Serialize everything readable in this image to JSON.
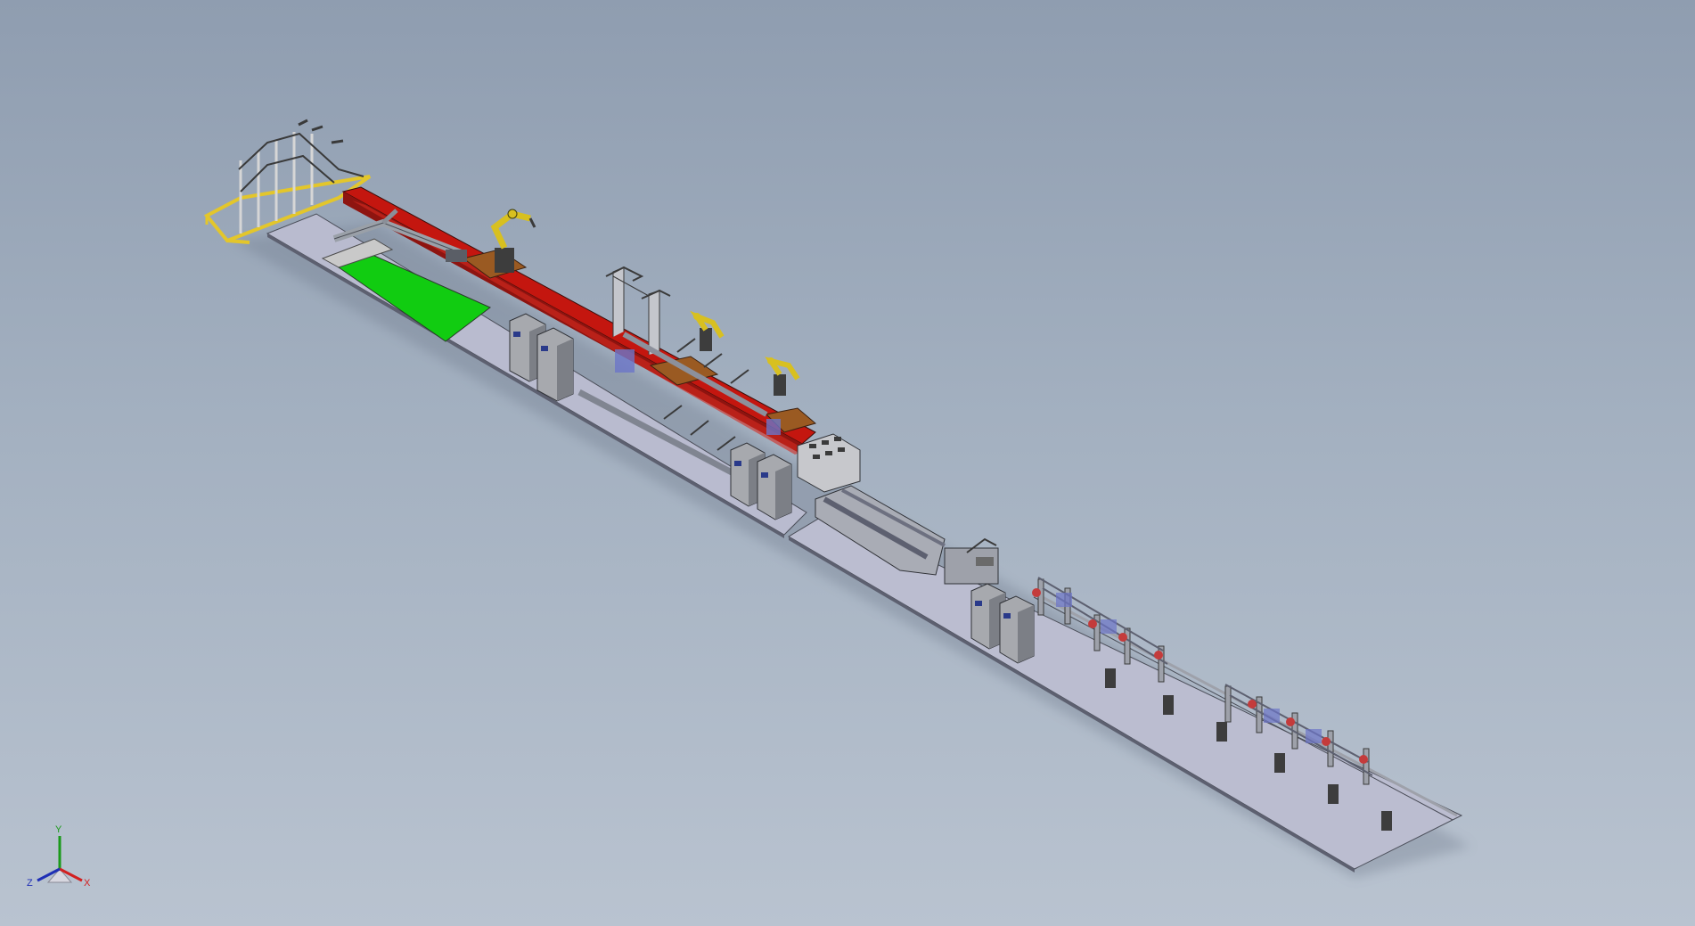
{
  "triad": {
    "x_label": "X",
    "y_label": "Y",
    "z_label": "Z"
  },
  "colors": {
    "background_top": "#8f9db0",
    "background_bottom": "#b9c3d0",
    "floor_plate": "#b8b9cc",
    "red_rail": "#c4160f",
    "green_zone": "#11cc11",
    "robot_yellow": "#d8c020",
    "cabinet_gray": "#a7a9ae",
    "brown_pad": "#9a5a22",
    "frame_yellow": "#e3c62b"
  }
}
